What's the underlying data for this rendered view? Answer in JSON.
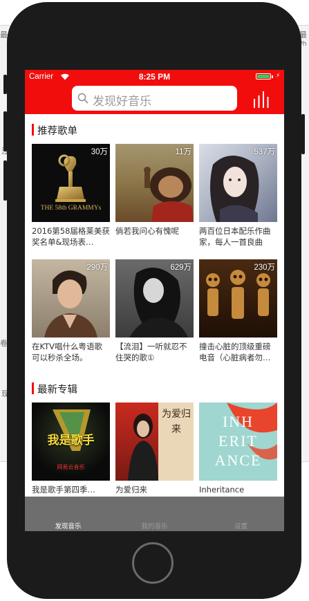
{
  "background": {
    "left_glyphs": [
      "最",
      "注",
      "卷",
      "现"
    ],
    "right_glyphs": [
      "最",
      "iPh"
    ]
  },
  "status_bar": {
    "carrier": "Carrier",
    "time": "8:25 PM",
    "battery_level": 1.0,
    "battery_color": "#35d05c",
    "background_color": "#f20d0d"
  },
  "nav": {
    "search_placeholder": "发现好音乐",
    "search_icon": "search-icon",
    "right_icon": "equalizer-bars-icon"
  },
  "recommended": {
    "title": "推荐歌单",
    "playlists": [
      {
        "count": "30万",
        "title": "2016第58届格莱美获奖名单&现场表…",
        "cover_icon": "grammy-award-cover",
        "cover_text": "THE 58th GRAMMYs"
      },
      {
        "count": "11万",
        "title": "倘若我问心有愧呢",
        "cover_icon": "monkey-king-cover"
      },
      {
        "count": "537万",
        "title": "两百位日本配乐作曲家，每人一首良曲",
        "cover_icon": "anime-girl-cover"
      },
      {
        "count": "290万",
        "title": "在KTV唱什么粤语歌可以秒杀全场。",
        "cover_icon": "singer-portrait-cover"
      },
      {
        "count": "629万",
        "title": "【流泪】一听就忍不住哭的歌①",
        "cover_icon": "sad-woman-cover"
      },
      {
        "count": "230万",
        "title": "撞击心脏的顶级重磅电音（心脏病者勿…",
        "cover_icon": "skeletons-cover"
      }
    ]
  },
  "new_albums": {
    "title": "最新专辑",
    "albums": [
      {
        "title": "我是歌手第四季…",
        "cover_icon": "i-am-singer-cover",
        "cover_text": "我是歌手",
        "cover_subtext": "网易云音乐"
      },
      {
        "title": "为爱归来",
        "cover_icon": "return-for-love-cover",
        "cover_text": "为爱归来"
      },
      {
        "title": "Inheritance",
        "cover_icon": "inheritance-cover",
        "cover_text": "INH ERIT ANCE"
      }
    ]
  },
  "tabs": [
    {
      "label": "发现音乐",
      "active": true
    },
    {
      "label": "我的音乐",
      "active": false
    },
    {
      "label": "设置",
      "active": false
    }
  ]
}
